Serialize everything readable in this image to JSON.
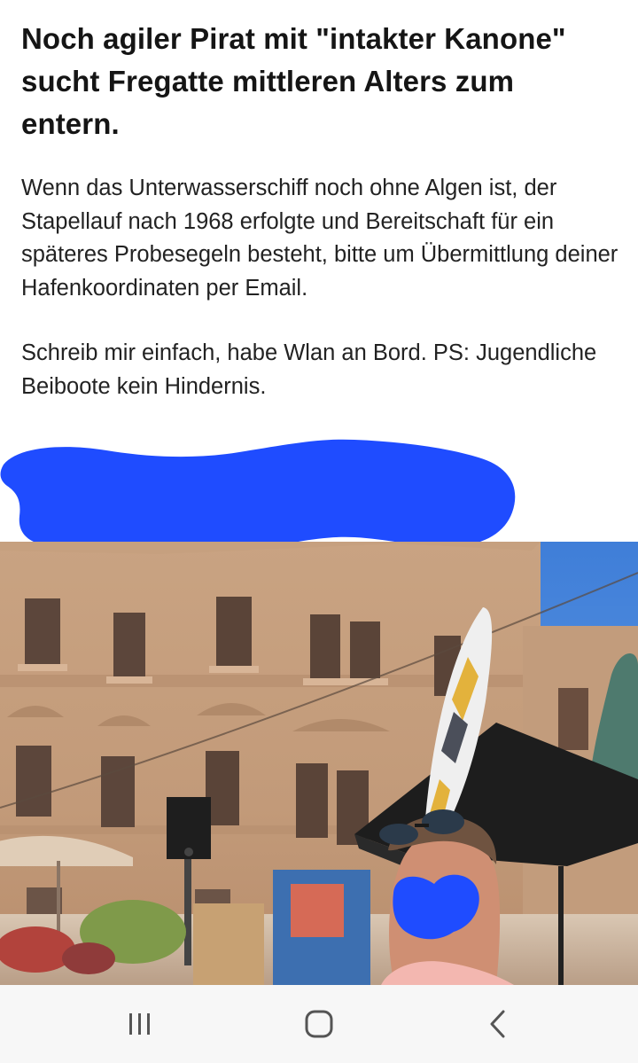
{
  "post": {
    "headline": "Noch agiler Pirat mit \"intakter Kanone\" sucht Fregatte mittleren Alters zum entern.",
    "paragraph_1": "Wenn das Unterwasserschiff noch ohne Algen ist, der Stapellauf nach 1968 erfolgte und Bereitschaft für ein späteres Probesegeln besteht, bitte um Übermittlung deiner Hafenkoordinaten per Email.",
    "paragraph_2": "Schreib mir einfach, habe Wlan an Bord. PS: Jugendliche Beiboote kein Hindernis."
  },
  "redaction_color": "#1f4cff",
  "navigation_bar": {
    "buttons": [
      "recent-apps",
      "home",
      "back"
    ]
  }
}
